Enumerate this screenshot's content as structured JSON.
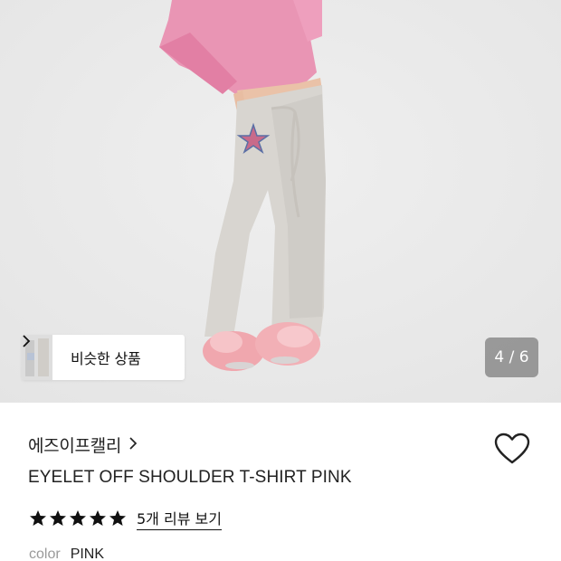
{
  "hero": {
    "image": "product-photo",
    "similar_products_label": "비슷한 상품",
    "page_counter": "4 / 6"
  },
  "product": {
    "brand": "에즈이프캘리",
    "title": "EYELET OFF SHOULDER T-SHIRT PINK",
    "rating_stars": 5,
    "review_link": "5개 리뷰 보기",
    "color_label": "color",
    "color_value": "PINK"
  },
  "colors": {
    "star": "#111111",
    "counter_bg": "#6e6e6e",
    "shirt": "#e98fb0",
    "pants": "#d9d6d1"
  }
}
